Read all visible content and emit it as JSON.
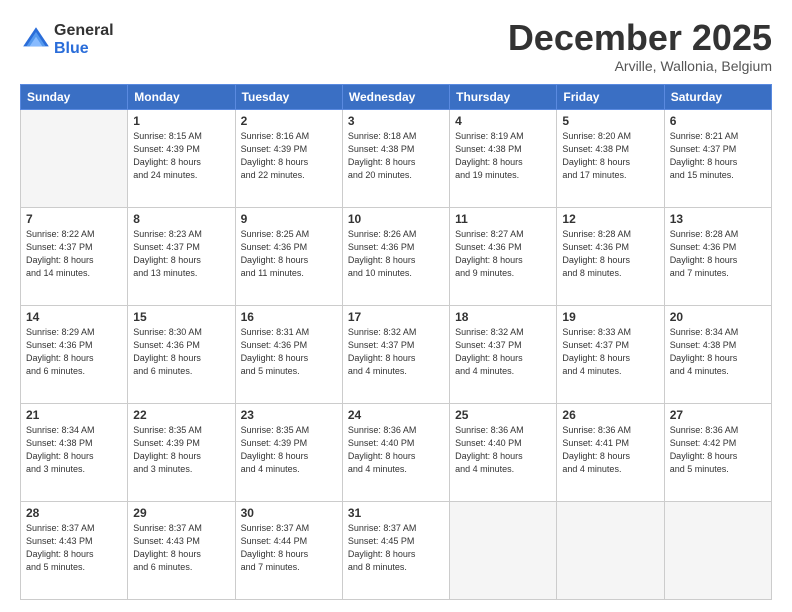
{
  "logo": {
    "general": "General",
    "blue": "Blue"
  },
  "title": "December 2025",
  "subtitle": "Arville, Wallonia, Belgium",
  "header_days": [
    "Sunday",
    "Monday",
    "Tuesday",
    "Wednesday",
    "Thursday",
    "Friday",
    "Saturday"
  ],
  "weeks": [
    [
      {
        "num": "",
        "info": ""
      },
      {
        "num": "1",
        "info": "Sunrise: 8:15 AM\nSunset: 4:39 PM\nDaylight: 8 hours\nand 24 minutes."
      },
      {
        "num": "2",
        "info": "Sunrise: 8:16 AM\nSunset: 4:39 PM\nDaylight: 8 hours\nand 22 minutes."
      },
      {
        "num": "3",
        "info": "Sunrise: 8:18 AM\nSunset: 4:38 PM\nDaylight: 8 hours\nand 20 minutes."
      },
      {
        "num": "4",
        "info": "Sunrise: 8:19 AM\nSunset: 4:38 PM\nDaylight: 8 hours\nand 19 minutes."
      },
      {
        "num": "5",
        "info": "Sunrise: 8:20 AM\nSunset: 4:38 PM\nDaylight: 8 hours\nand 17 minutes."
      },
      {
        "num": "6",
        "info": "Sunrise: 8:21 AM\nSunset: 4:37 PM\nDaylight: 8 hours\nand 15 minutes."
      }
    ],
    [
      {
        "num": "7",
        "info": "Sunrise: 8:22 AM\nSunset: 4:37 PM\nDaylight: 8 hours\nand 14 minutes."
      },
      {
        "num": "8",
        "info": "Sunrise: 8:23 AM\nSunset: 4:37 PM\nDaylight: 8 hours\nand 13 minutes."
      },
      {
        "num": "9",
        "info": "Sunrise: 8:25 AM\nSunset: 4:36 PM\nDaylight: 8 hours\nand 11 minutes."
      },
      {
        "num": "10",
        "info": "Sunrise: 8:26 AM\nSunset: 4:36 PM\nDaylight: 8 hours\nand 10 minutes."
      },
      {
        "num": "11",
        "info": "Sunrise: 8:27 AM\nSunset: 4:36 PM\nDaylight: 8 hours\nand 9 minutes."
      },
      {
        "num": "12",
        "info": "Sunrise: 8:28 AM\nSunset: 4:36 PM\nDaylight: 8 hours\nand 8 minutes."
      },
      {
        "num": "13",
        "info": "Sunrise: 8:28 AM\nSunset: 4:36 PM\nDaylight: 8 hours\nand 7 minutes."
      }
    ],
    [
      {
        "num": "14",
        "info": "Sunrise: 8:29 AM\nSunset: 4:36 PM\nDaylight: 8 hours\nand 6 minutes."
      },
      {
        "num": "15",
        "info": "Sunrise: 8:30 AM\nSunset: 4:36 PM\nDaylight: 8 hours\nand 6 minutes."
      },
      {
        "num": "16",
        "info": "Sunrise: 8:31 AM\nSunset: 4:36 PM\nDaylight: 8 hours\nand 5 minutes."
      },
      {
        "num": "17",
        "info": "Sunrise: 8:32 AM\nSunset: 4:37 PM\nDaylight: 8 hours\nand 4 minutes."
      },
      {
        "num": "18",
        "info": "Sunrise: 8:32 AM\nSunset: 4:37 PM\nDaylight: 8 hours\nand 4 minutes."
      },
      {
        "num": "19",
        "info": "Sunrise: 8:33 AM\nSunset: 4:37 PM\nDaylight: 8 hours\nand 4 minutes."
      },
      {
        "num": "20",
        "info": "Sunrise: 8:34 AM\nSunset: 4:38 PM\nDaylight: 8 hours\nand 4 minutes."
      }
    ],
    [
      {
        "num": "21",
        "info": "Sunrise: 8:34 AM\nSunset: 4:38 PM\nDaylight: 8 hours\nand 3 minutes."
      },
      {
        "num": "22",
        "info": "Sunrise: 8:35 AM\nSunset: 4:39 PM\nDaylight: 8 hours\nand 3 minutes."
      },
      {
        "num": "23",
        "info": "Sunrise: 8:35 AM\nSunset: 4:39 PM\nDaylight: 8 hours\nand 4 minutes."
      },
      {
        "num": "24",
        "info": "Sunrise: 8:36 AM\nSunset: 4:40 PM\nDaylight: 8 hours\nand 4 minutes."
      },
      {
        "num": "25",
        "info": "Sunrise: 8:36 AM\nSunset: 4:40 PM\nDaylight: 8 hours\nand 4 minutes."
      },
      {
        "num": "26",
        "info": "Sunrise: 8:36 AM\nSunset: 4:41 PM\nDaylight: 8 hours\nand 4 minutes."
      },
      {
        "num": "27",
        "info": "Sunrise: 8:36 AM\nSunset: 4:42 PM\nDaylight: 8 hours\nand 5 minutes."
      }
    ],
    [
      {
        "num": "28",
        "info": "Sunrise: 8:37 AM\nSunset: 4:43 PM\nDaylight: 8 hours\nand 5 minutes."
      },
      {
        "num": "29",
        "info": "Sunrise: 8:37 AM\nSunset: 4:43 PM\nDaylight: 8 hours\nand 6 minutes."
      },
      {
        "num": "30",
        "info": "Sunrise: 8:37 AM\nSunset: 4:44 PM\nDaylight: 8 hours\nand 7 minutes."
      },
      {
        "num": "31",
        "info": "Sunrise: 8:37 AM\nSunset: 4:45 PM\nDaylight: 8 hours\nand 8 minutes."
      },
      {
        "num": "",
        "info": ""
      },
      {
        "num": "",
        "info": ""
      },
      {
        "num": "",
        "info": ""
      }
    ]
  ]
}
